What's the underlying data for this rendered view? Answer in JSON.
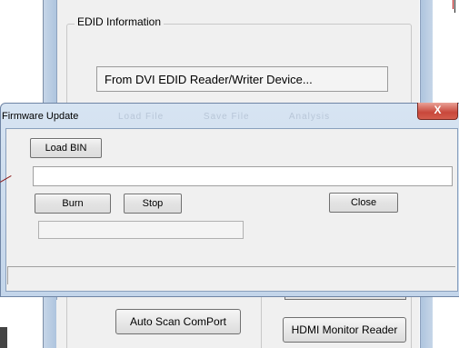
{
  "background_window": {
    "group_title": "EDID Information",
    "edid_source_field": "From DVI EDID Reader/Writer Device...",
    "auto_scan_button": "Auto Scan ComPort",
    "hdmi_reader_button": "HDMI Monitor Reader",
    "obscured_toolbar": [
      "Load File",
      "Save File",
      "Analysis"
    ]
  },
  "firmware_dialog": {
    "title": "Firmware Update",
    "close_glyph": "X",
    "load_bin_button": "Load BIN",
    "file_path_value": "",
    "burn_button": "Burn",
    "stop_button": "Stop",
    "close_button": "Close",
    "status_field_value": "",
    "statusbar_text": ""
  },
  "colors": {
    "frame": "#c3d5ea",
    "close_red": "#c8473b",
    "client_bg": "#f0f0f0"
  }
}
